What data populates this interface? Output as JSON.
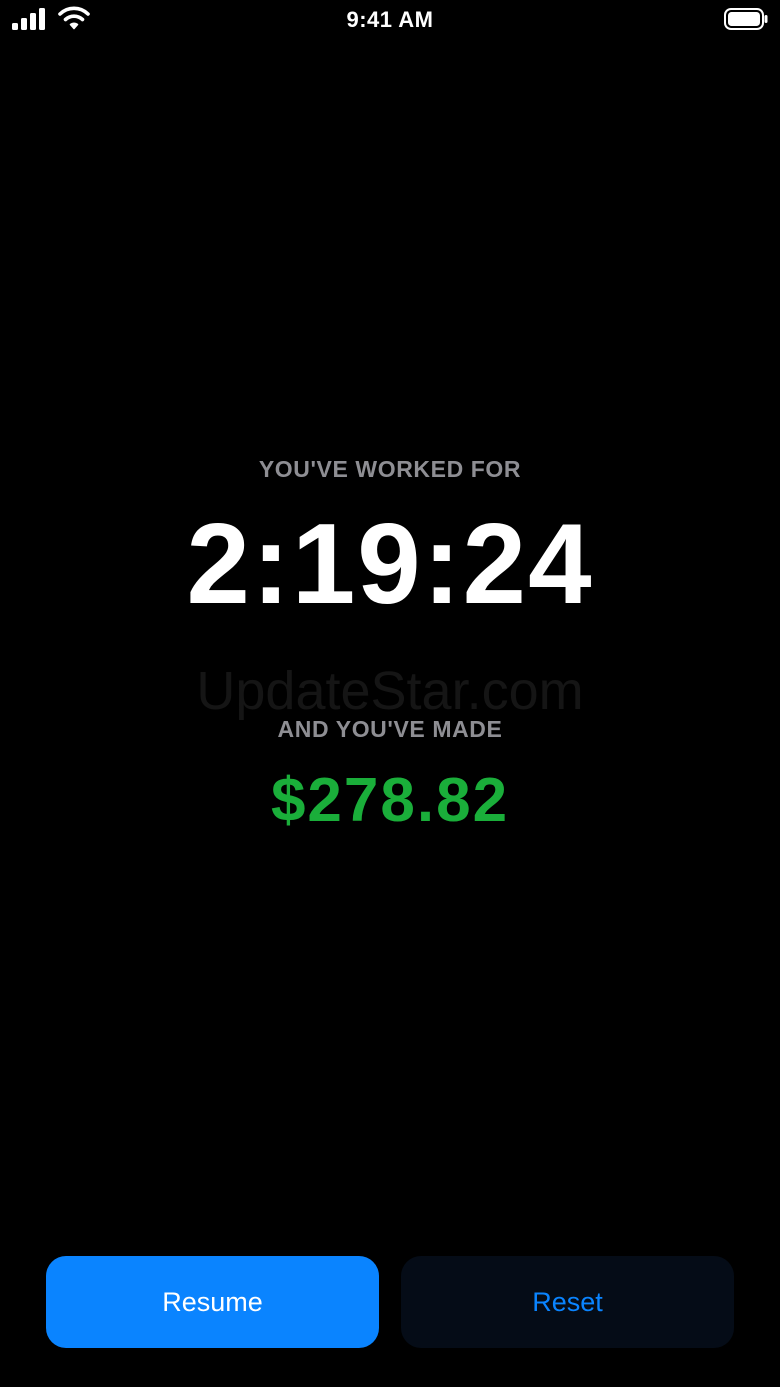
{
  "status_bar": {
    "time": "9:41 AM",
    "signal_icon": "cellular-signal-icon",
    "wifi_icon": "wifi-icon",
    "battery_icon": "battery-icon"
  },
  "session": {
    "worked_label": "YOU'VE WORKED FOR",
    "elapsed_time": "2:19:24",
    "made_label": "AND YOU'VE MADE",
    "earnings": "$278.82"
  },
  "watermark": "UpdateStar.com",
  "actions": {
    "resume_label": "Resume",
    "reset_label": "Reset"
  },
  "colors": {
    "background": "#000000",
    "accent_blue": "#0a84ff",
    "earnings_green": "#1aae3a",
    "label_gray": "#8e8e93",
    "reset_button_bg": "#050c17"
  }
}
